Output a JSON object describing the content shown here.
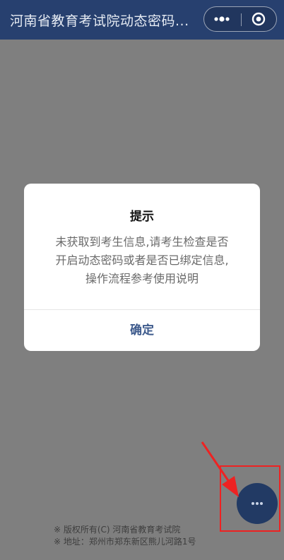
{
  "navbar": {
    "title": "河南省教育考试院动态密码..."
  },
  "modal": {
    "title": "提示",
    "content_lines": [
      "未获取到考生信息,请考生检查是否",
      "开启动态密码或者是否已绑定信息,",
      "操作流程参考使用说明"
    ],
    "confirm_label": "确定"
  },
  "footer": {
    "copyright": "※ 版权所有(C) 河南省教育考试院",
    "address": "※ 地址：郑州市郑东新区熊儿河路1号"
  },
  "colors": {
    "navbar_bg": "#27406f",
    "overlay": "#7f7f7f",
    "confirm_text": "#3d5a8c",
    "annotation": "#ee2222",
    "fab_bg": "#223a64"
  },
  "icons": {
    "more": "more-dots-icon",
    "close": "target-close-icon",
    "fab": "ellipsis-icon"
  }
}
